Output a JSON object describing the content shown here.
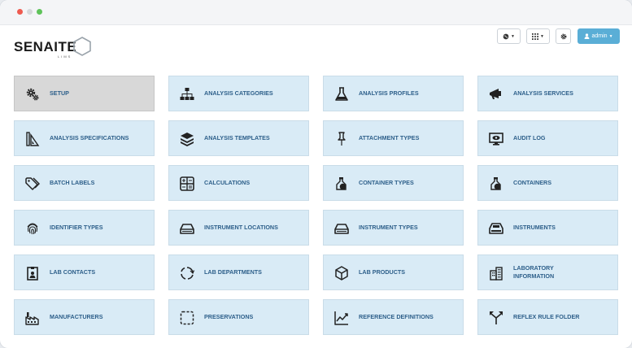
{
  "window": {
    "controls": [
      "close",
      "minimize",
      "maximize"
    ]
  },
  "header": {
    "logo_text": "SENAITE",
    "logo_sub": "LIMS",
    "language_icon": "globe-icon",
    "apps_icon": "grid-icon",
    "settings_icon": "gear-icon",
    "user_label": "admin",
    "user_icon": "user-icon"
  },
  "colors": {
    "tile_bg": "#d9ebf6",
    "tile_active_bg": "#d8d8d8",
    "tile_text": "#2d5f8a",
    "user_button": "#5aaed6"
  },
  "tiles": [
    {
      "label": "SETUP",
      "icon": "gears-icon",
      "active": true
    },
    {
      "label": "ANALYSIS CATEGORIES",
      "icon": "sitemap-icon"
    },
    {
      "label": "ANALYSIS PROFILES",
      "icon": "flask-icon"
    },
    {
      "label": "ANALYSIS SERVICES",
      "icon": "bullhorn-icon"
    },
    {
      "label": "ANALYSIS SPECIFICATIONS",
      "icon": "ruler-icon"
    },
    {
      "label": "ANALYSIS TEMPLATES",
      "icon": "layers-icon"
    },
    {
      "label": "ATTACHMENT TYPES",
      "icon": "pushpin-icon"
    },
    {
      "label": "AUDIT LOG",
      "icon": "monitor-eye-icon"
    },
    {
      "label": "BATCH LABELS",
      "icon": "tags-icon"
    },
    {
      "label": "CALCULATIONS",
      "icon": "calculator-icon"
    },
    {
      "label": "CONTAINER TYPES",
      "icon": "bottle-icon"
    },
    {
      "label": "CONTAINERS",
      "icon": "bottle-icon"
    },
    {
      "label": "IDENTIFIER TYPES",
      "icon": "fingerprint-icon"
    },
    {
      "label": "INSTRUMENT LOCATIONS",
      "icon": "tray-icon"
    },
    {
      "label": "INSTRUMENT TYPES",
      "icon": "tray-icon"
    },
    {
      "label": "INSTRUMENTS",
      "icon": "scanner-icon"
    },
    {
      "label": "LAB CONTACTS",
      "icon": "id-badge-icon"
    },
    {
      "label": "LAB DEPARTMENTS",
      "icon": "circle-arrows-icon"
    },
    {
      "label": "LAB PRODUCTS",
      "icon": "cube-icon"
    },
    {
      "label": "LABORATORY INFORMATION",
      "icon": "building-icon"
    },
    {
      "label": "MANUFACTURERS",
      "icon": "factory-icon"
    },
    {
      "label": "PRESERVATIONS",
      "icon": "dashed-square-icon"
    },
    {
      "label": "REFERENCE DEFINITIONS",
      "icon": "chart-line-icon"
    },
    {
      "label": "REFLEX RULE FOLDER",
      "icon": "split-arrows-icon"
    }
  ]
}
